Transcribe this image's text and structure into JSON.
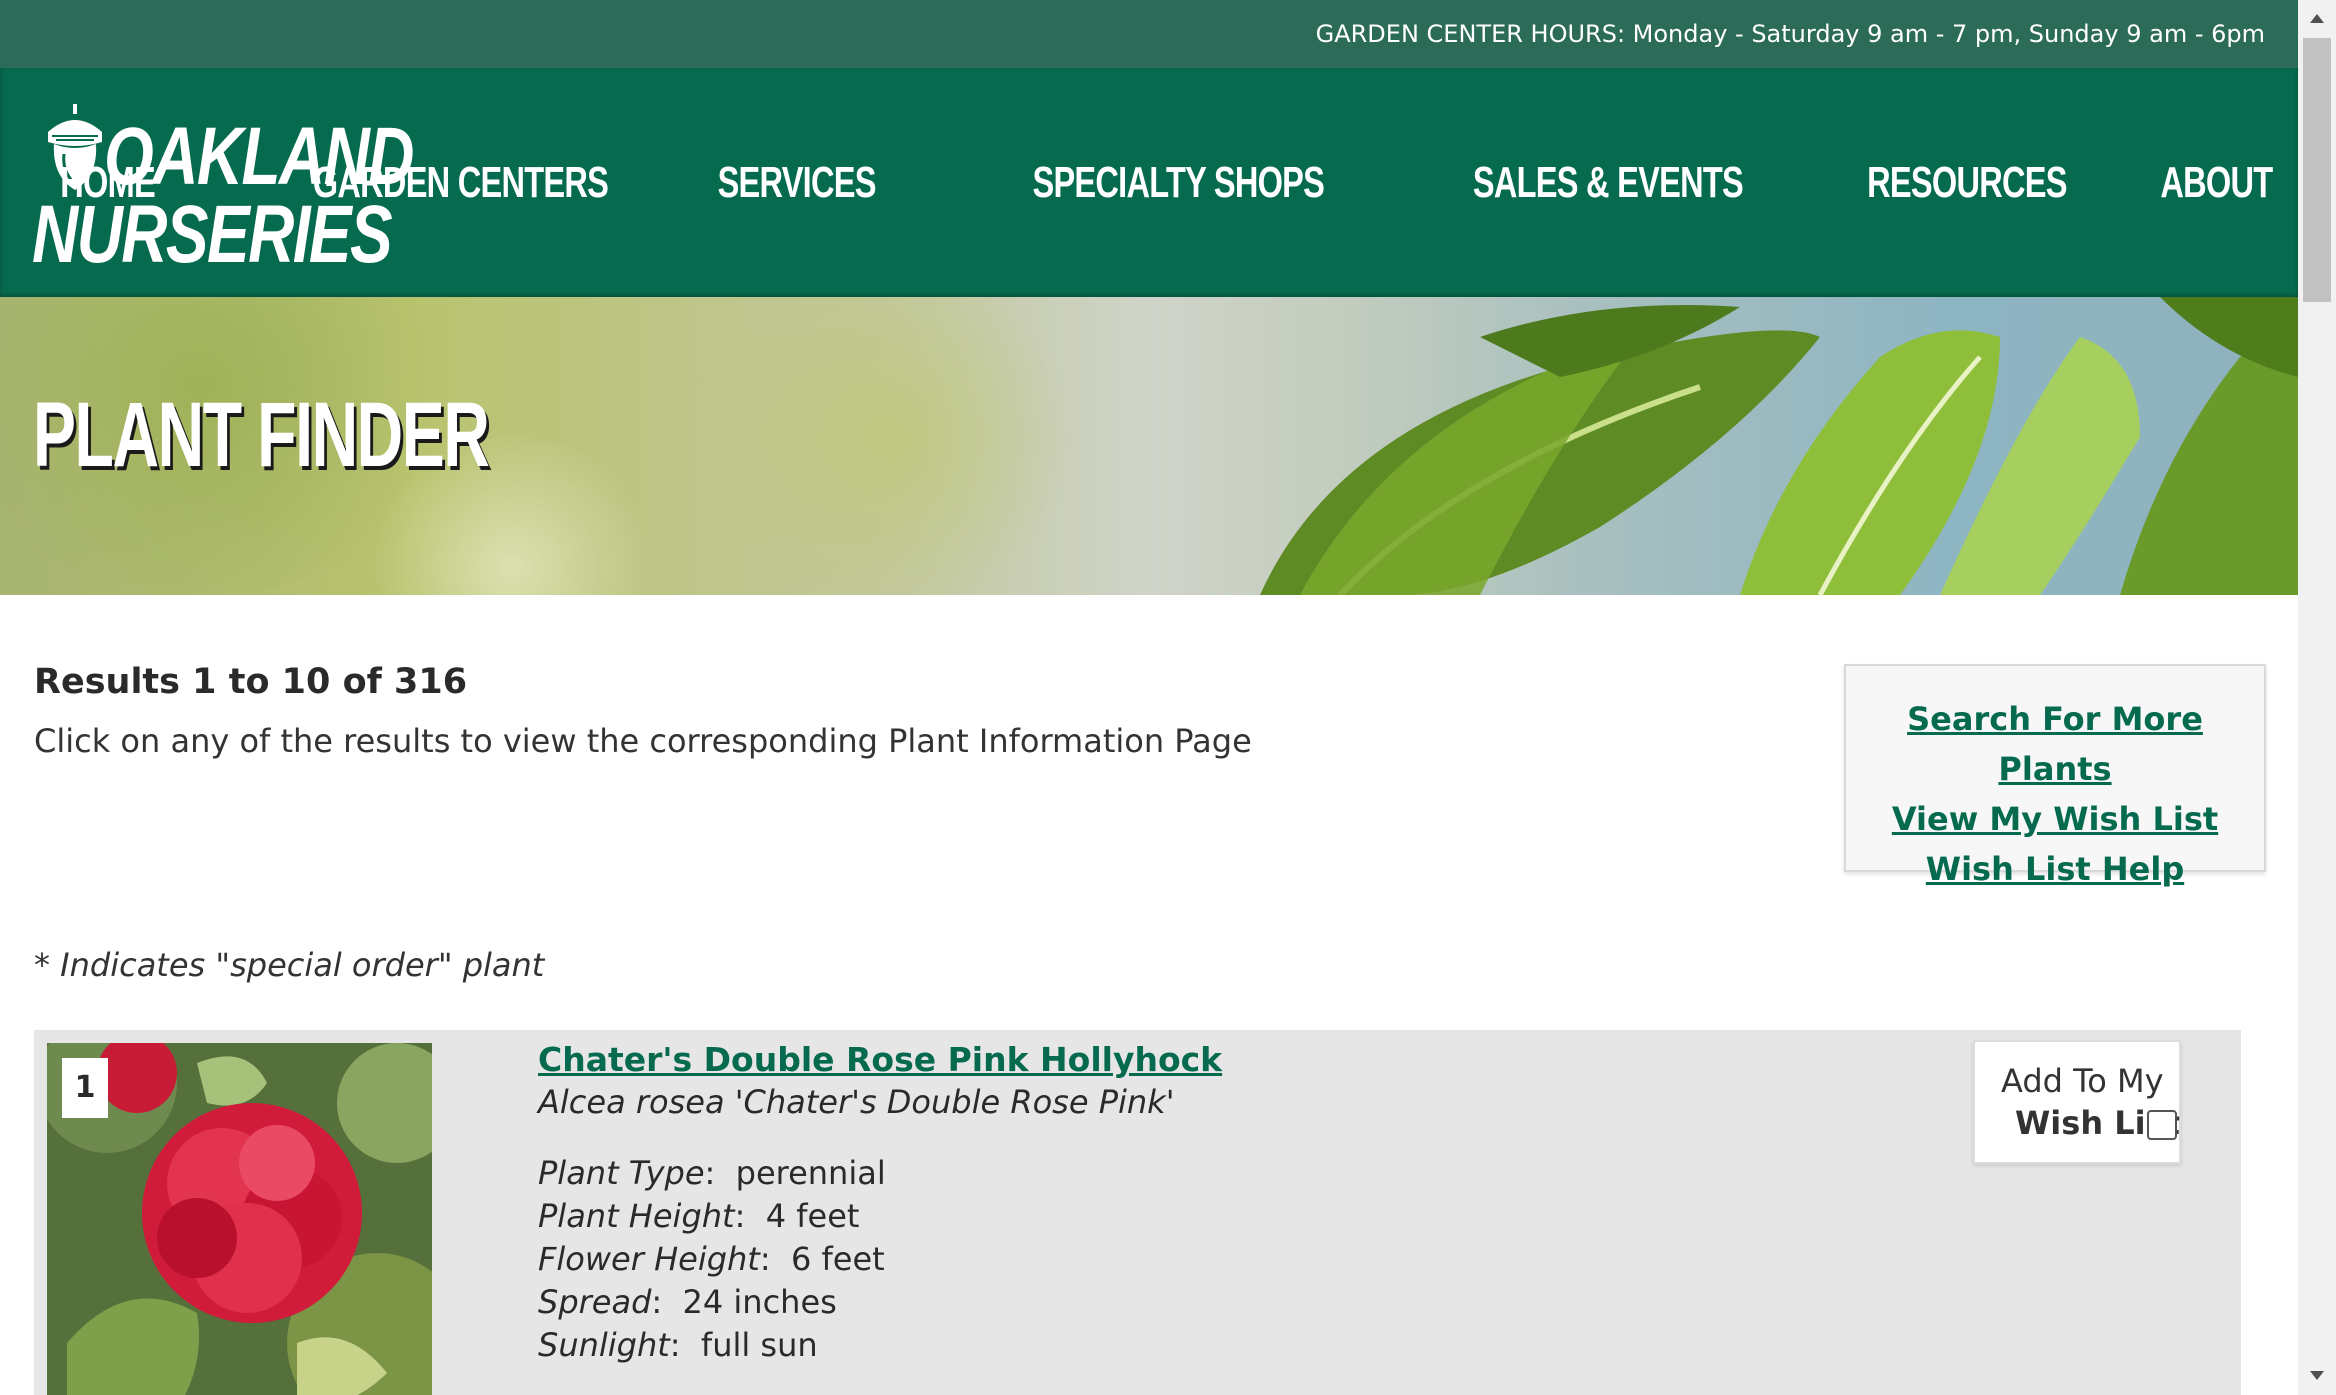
{
  "topbar": {
    "hours": "GARDEN CENTER HOURS: Monday - Saturday 9 am - 7 pm, Sunday 9 am - 6pm"
  },
  "header": {
    "logo_line1": "OAKLAND",
    "logo_line2": "NURSERIES",
    "logo_icon": "acorn-icon",
    "nav": [
      "HOME",
      "GARDEN CENTERS",
      "SERVICES",
      "SPECIALTY SHOPS",
      "SALES & EVENTS",
      "RESOURCES",
      "ABOUT"
    ]
  },
  "hero": {
    "title": "PLANT FINDER"
  },
  "results": {
    "title": "Results 1 to 10 of 316",
    "description": "Click on any of the results to view the corresponding Plant Information Page",
    "special_note": "* Indicates \"special order\" plant"
  },
  "side_links": [
    "Search For More Plants",
    "View My Wish List",
    "Wish List Help"
  ],
  "items": [
    {
      "number": "1",
      "name": "Chater's Double Rose Pink Hollyhock",
      "latin": "Alcea rosea 'Chater's Double Rose Pink'",
      "attributes": [
        {
          "key": "Plant Type",
          "value": "perennial"
        },
        {
          "key": "Plant Height",
          "value": "4 feet"
        },
        {
          "key": "Flower Height",
          "value": "6 feet"
        },
        {
          "key": "Spread",
          "value": "24 inches"
        },
        {
          "key": "Sunlight",
          "value": "full sun"
        }
      ],
      "wish_line1": "Add To My",
      "wish_line2": "Wish List",
      "wish_checked": false
    }
  ],
  "colors": {
    "topbar": "#2c6b58",
    "header": "#066a4e",
    "link": "#066a4e",
    "card_bg": "#e6e6e6"
  }
}
